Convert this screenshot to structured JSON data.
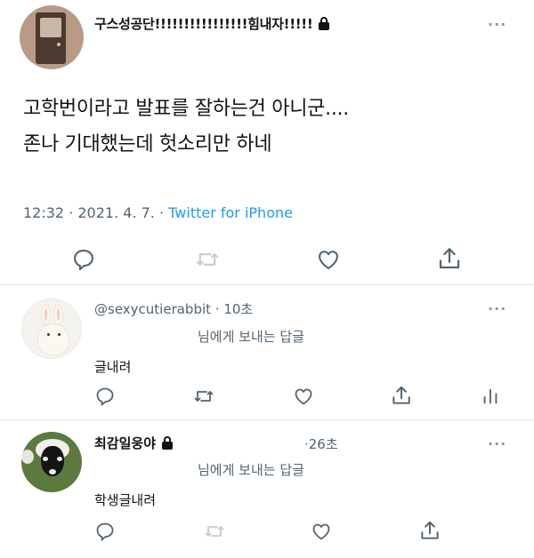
{
  "main_tweet": {
    "display_name": "구스성공단!!!!!!!!!!!!!!!!힘내자!!!!!",
    "protected": true,
    "text_lines": [
      "고학번이라고 발표를 잘하는건 아니군....",
      "존나 기대했는데 헛소리만 하네"
    ],
    "time": "12:32",
    "date": "2021. 4. 7.",
    "source": "Twitter for iPhone",
    "separator": " · ",
    "more": "···",
    "icons": [
      "reply-icon",
      "retweet-icon",
      "like-icon",
      "share-icon"
    ]
  },
  "replies": [
    {
      "handle": "@sexycutierabbit",
      "time": "10초",
      "separator": " · ",
      "replying_to": "님에게 보내는 답글",
      "text": "글내려",
      "more": "···",
      "icons": [
        "reply-icon",
        "retweet-icon",
        "like-icon",
        "share-icon",
        "analytics-icon"
      ]
    },
    {
      "display_name": "최감일웅야",
      "protected": true,
      "time": "·26초",
      "replying_to": "님에게 보내는 답글",
      "text": "학생글내려",
      "more": "···",
      "icons": [
        "reply-icon",
        "retweet-icon",
        "like-icon",
        "share-icon"
      ]
    }
  ],
  "colors": {
    "text": "#0f1419",
    "secondary": "#536471",
    "accent": "#1d9bf0",
    "divider": "#e6e9ea"
  }
}
